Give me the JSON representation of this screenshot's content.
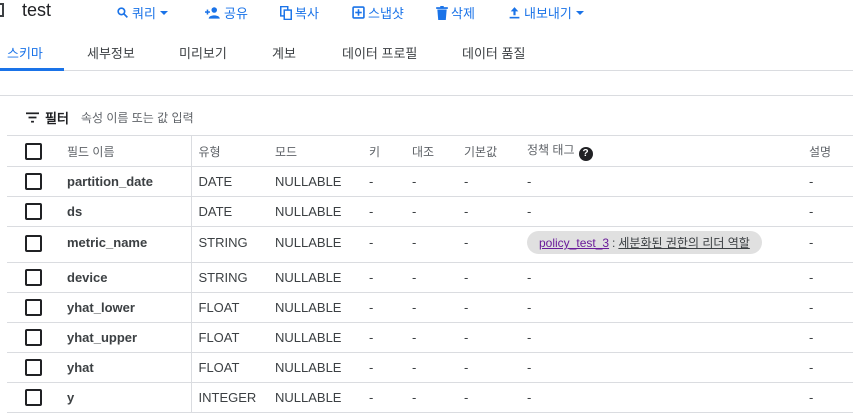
{
  "header": {
    "title": "test",
    "actions": [
      {
        "label": "쿼리",
        "icon": "search-icon"
      },
      {
        "label": "공유",
        "icon": "person-add-icon"
      },
      {
        "label": "복사",
        "icon": "copy-icon"
      },
      {
        "label": "스냅샷",
        "icon": "snapshot-icon"
      },
      {
        "label": "삭제",
        "icon": "trash-icon"
      },
      {
        "label": "내보내기",
        "icon": "upload-icon"
      }
    ]
  },
  "tabs": [
    {
      "label": "스키마",
      "active": true
    },
    {
      "label": "세부정보"
    },
    {
      "label": "미리보기"
    },
    {
      "label": "계보"
    },
    {
      "label": "데이터 프로필"
    },
    {
      "label": "데이터 품질"
    }
  ],
  "filter": {
    "label": "필터",
    "placeholder": "속성 이름 또는 값 입력"
  },
  "table": {
    "columns": [
      "필드 이름",
      "유형",
      "모드",
      "키",
      "대조",
      "기본값",
      "정책 태그",
      "설명"
    ],
    "rows": [
      {
        "name": "partition_date",
        "type": "DATE",
        "mode": "NULLABLE",
        "key": "-",
        "collation": "-",
        "default": "-",
        "policy": "-",
        "description": "-"
      },
      {
        "name": "ds",
        "type": "DATE",
        "mode": "NULLABLE",
        "key": "-",
        "collation": "-",
        "default": "-",
        "policy": "-",
        "description": "-"
      },
      {
        "name": "metric_name",
        "type": "STRING",
        "mode": "NULLABLE",
        "key": "-",
        "collation": "-",
        "default": "-",
        "policy": "",
        "description": "-"
      },
      {
        "name": "device",
        "type": "STRING",
        "mode": "NULLABLE",
        "key": "-",
        "collation": "-",
        "default": "-",
        "policy": "-",
        "description": "-"
      },
      {
        "name": "yhat_lower",
        "type": "FLOAT",
        "mode": "NULLABLE",
        "key": "-",
        "collation": "-",
        "default": "-",
        "policy": "-",
        "description": "-"
      },
      {
        "name": "yhat_upper",
        "type": "FLOAT",
        "mode": "NULLABLE",
        "key": "-",
        "collation": "-",
        "default": "-",
        "policy": "-",
        "description": "-"
      },
      {
        "name": "yhat",
        "type": "FLOAT",
        "mode": "NULLABLE",
        "key": "-",
        "collation": "-",
        "default": "-",
        "policy": "-",
        "description": "-"
      },
      {
        "name": "y",
        "type": "INTEGER",
        "mode": "NULLABLE",
        "key": "-",
        "collation": "-",
        "default": "-",
        "policy": "-",
        "description": "-"
      }
    ],
    "policy_tag": {
      "name": "policy_test_3",
      "separator": ":",
      "description": "세분화된 권한의 리더 역할"
    }
  },
  "colors": {
    "accent": "#1a73e8",
    "policy_link": "#6a1b9a",
    "chip_bg": "#e0e0e0",
    "border": "#dadce0"
  }
}
